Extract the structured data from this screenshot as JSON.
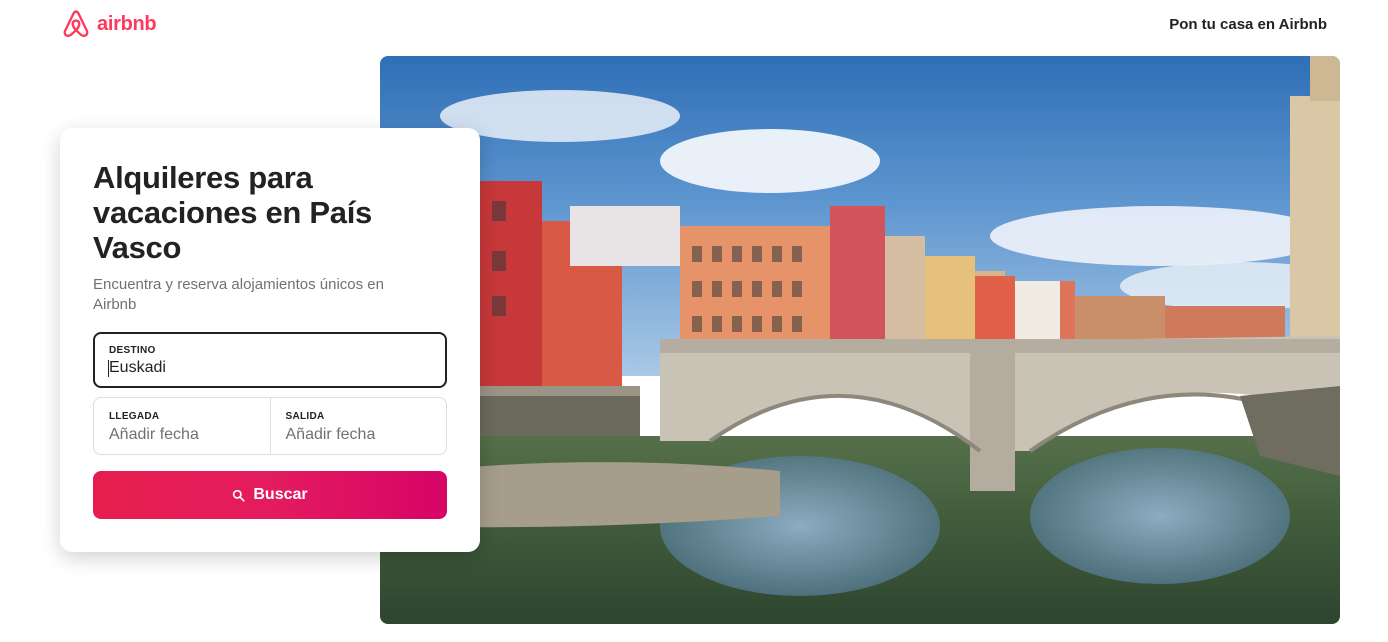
{
  "header": {
    "brand": "airbnb",
    "host_link": "Pon tu casa en Airbnb"
  },
  "search_card": {
    "title": "Alquileres para vacaciones en País Vasco",
    "subtitle": "Encuentra y reserva alojamientos únicos en Airbnb",
    "destination": {
      "label": "DESTINO",
      "value": "Euskadi"
    },
    "check_in": {
      "label": "LLEGADA",
      "placeholder": "Añadir fecha"
    },
    "check_out": {
      "label": "SALIDA",
      "placeholder": "Añadir fecha"
    },
    "search_button": "Buscar"
  },
  "hero": {
    "icon": "bilbao-bridge-photo"
  },
  "colors": {
    "brand": "#FF385C",
    "button_start": "#E61E4D",
    "button_end": "#D70466",
    "text_primary": "#222222",
    "text_secondary": "#717171"
  }
}
